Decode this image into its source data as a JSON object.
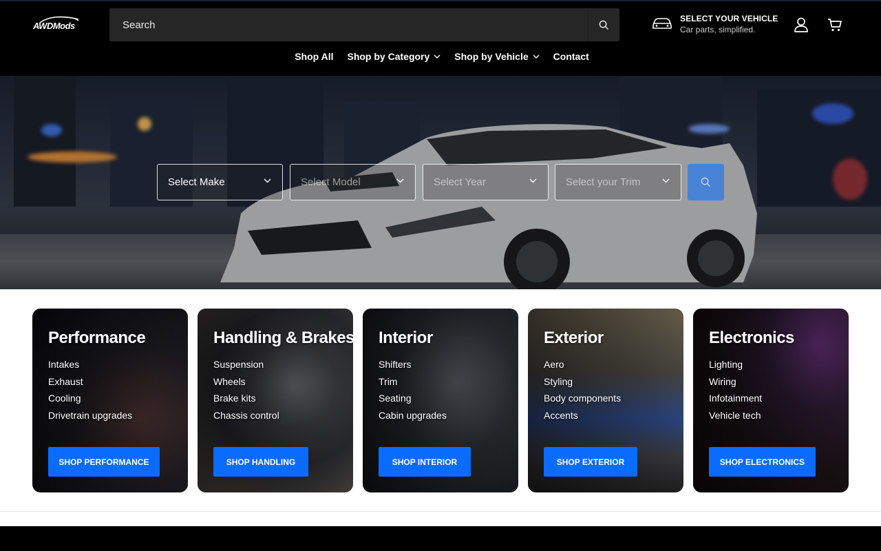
{
  "brand": {
    "logo_text": "AWDMods"
  },
  "search": {
    "placeholder": "Search"
  },
  "vehicle": {
    "title": "SELECT YOUR VEHICLE",
    "subtitle": "Car parts, simplified."
  },
  "nav": [
    {
      "label": "Shop All"
    },
    {
      "label": "Shop by Category"
    },
    {
      "label": "Shop by Vehicle"
    },
    {
      "label": "Contact"
    }
  ],
  "finder": {
    "make": "Select Make",
    "model": "Select Model",
    "year": "Select Year",
    "trim": "Select your Trim"
  },
  "categories": [
    {
      "title": "Performance",
      "items": [
        "Intakes",
        "Exhaust",
        "Cooling",
        "Drivetrain upgrades"
      ],
      "button": "SHOP PERFORMANCE"
    },
    {
      "title": "Handling & Brakes",
      "items": [
        "Suspension",
        "Wheels",
        "Brake kits",
        "Chassis control"
      ],
      "button": "SHOP HANDLING"
    },
    {
      "title": "Interior",
      "items": [
        "Shifters",
        "Trim",
        "Seating",
        "Cabin upgrades"
      ],
      "button": "SHOP INTERIOR"
    },
    {
      "title": "Exterior",
      "items": [
        "Aero",
        "Styling",
        "Body components",
        "Accents"
      ],
      "button": "SHOP EXTERIOR"
    },
    {
      "title": "Electronics",
      "items": [
        "Lighting",
        "Wiring",
        "Infotainment",
        "Vehicle tech"
      ],
      "button": "SHOP ELECTRONICS"
    }
  ],
  "colors": {
    "accent": "#0a6cff",
    "header_bg": "#000000",
    "search_bg": "#262626"
  }
}
